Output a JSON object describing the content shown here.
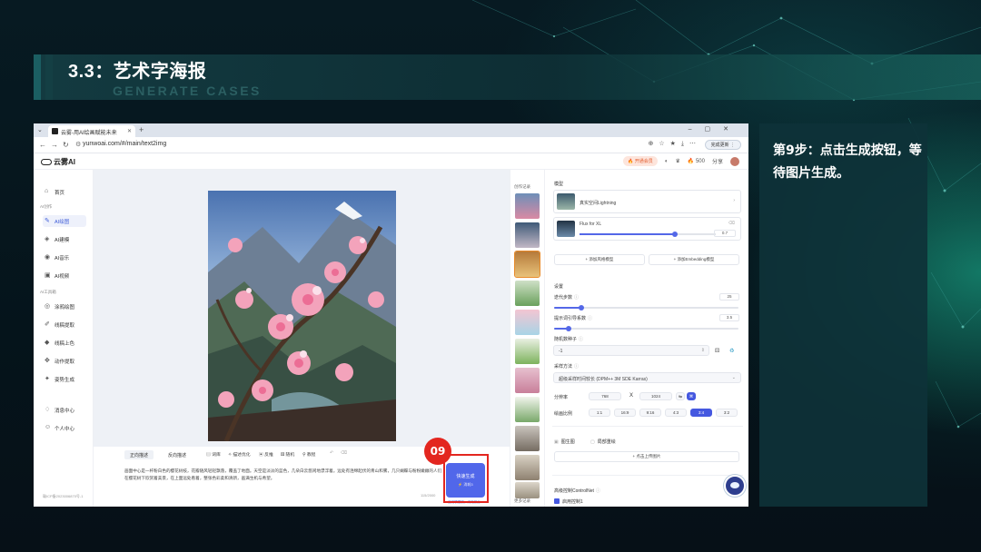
{
  "slide": {
    "title": "3.3：艺术字海报",
    "subtitle": "GENERATE CASES",
    "step_text": "第9步：点击生成按钮，等待图片生成。",
    "step_badge": "09",
    "colors": {
      "highlight": "#e3261f",
      "accent": "#5167ea",
      "panel": "#0e3238"
    }
  },
  "browser": {
    "tab_title": "云雾-用AI绘画赋能未来",
    "tab_favicon": "app-favicon-icon",
    "url": "yunwoai.com/#/main/text2img",
    "window_controls": [
      "–",
      "▢",
      "✕"
    ],
    "profile_label": "完成更新 ⋮"
  },
  "app": {
    "logo": "云雾AI",
    "header": {
      "vip_label": "🔥 开通会员",
      "points": "🔥 500",
      "share": "分享"
    },
    "sidebar": {
      "home": "首页",
      "section_ai": "AI创作",
      "items_ai": [
        {
          "label": "AI绘图",
          "icon": "brush-icon",
          "active": true
        },
        {
          "label": "AI建模",
          "icon": "cube-icon",
          "active": false
        },
        {
          "label": "AI音乐",
          "icon": "music-icon",
          "active": false
        },
        {
          "label": "AI视频",
          "icon": "video-icon",
          "active": false
        }
      ],
      "section_tools": "AI工具箱",
      "items_tools": [
        {
          "label": "涂鸦绘图",
          "icon": "scribble-icon"
        },
        {
          "label": "线稿提取",
          "icon": "lineart-icon"
        },
        {
          "label": "线稿上色",
          "icon": "paint-bucket-icon"
        },
        {
          "label": "动作提取",
          "icon": "pose-icon"
        },
        {
          "label": "姿势生成",
          "icon": "figure-icon"
        }
      ],
      "messages": "消息中心",
      "profile": "个人中心",
      "footer": "赣ICP备2023006870号-1"
    },
    "right_tools": [
      {
        "label": "发布",
        "icon": "send-icon"
      },
      {
        "label": "下载",
        "icon": "download-icon"
      },
      {
        "label": "删除",
        "icon": "trash-icon"
      },
      {
        "label": "图生图",
        "icon": "image-to-image-icon"
      },
      {
        "label": "局部重绘",
        "icon": "inpaint-icon"
      },
      {
        "label": "放大",
        "icon": "upscale-icon"
      },
      {
        "label": "抠图",
        "icon": "cutout-icon"
      },
      {
        "label": "人物修复",
        "icon": "face-fix-icon"
      },
      {
        "label": "图生3D",
        "icon": "3d-icon"
      },
      {
        "label": "图生视频",
        "icon": "image-to-video-icon"
      }
    ],
    "history": {
      "title": "创作记录",
      "more": "更多记录"
    },
    "settings": {
      "model_label": "模型",
      "model_name": "真实空间Lightning",
      "lora_name": "Flux for XL",
      "lora_value": "0.7",
      "lora_weight": 0.7,
      "add_lora": "+ 添加风格模型",
      "add_embedding": "+ 添加Embedding模型",
      "settings_label": "设置",
      "steps_label": "迭代步数",
      "steps_value": "25",
      "steps_fraction": 0.15,
      "cfg_label": "提示词引导系数",
      "cfg_value": "3.5",
      "cfg_fraction": 0.08,
      "seed_label": "随机数种子",
      "seed_value": "-1",
      "sampler_label": "采样方法",
      "sampler_value": "超级采样时间较长 (DPM++ 3M SDE Karras)",
      "resolution_label": "分辨率",
      "width": "768",
      "x_sign": "X",
      "height": "1024",
      "ratio_label": "绘画比例",
      "ratios": [
        "1:1",
        "16:9",
        "9:16",
        "4:3",
        "3:4",
        "3:2"
      ],
      "ratio_selected": "3:4",
      "img2img_label": "图生图",
      "inpaint_label": "局部重绘",
      "upload_label": "+ 点击上传图片",
      "controlnet_label": "高级控制ControlNet",
      "controlnet_toggle": "启用控制1"
    },
    "prompt": {
      "tab_positive": "正向描述",
      "tab_negative": "反向描述",
      "tools": [
        "词库",
        "描述优化",
        "反推",
        "随机",
        "教程"
      ],
      "text": "画面中心是一杆粉白色的樱花树枝，花瓣随风轻轻飘落，覆盖了地面。天空是淡淡的蓝色，几朵白云悠闲地漂浮着。远处有连绵起伏的青山和雾，几只蝴蝶与粉粉嫩嫩的人们在樱花树下欣赏着美景，在上面远处看着，整张色彩柔和清新，画满生机与希望。",
      "count": "115/2000",
      "generate_label": "快速生成",
      "generate_sub": "⚡ 消耗3",
      "hint": "使用联想前，消耗积分"
    }
  }
}
